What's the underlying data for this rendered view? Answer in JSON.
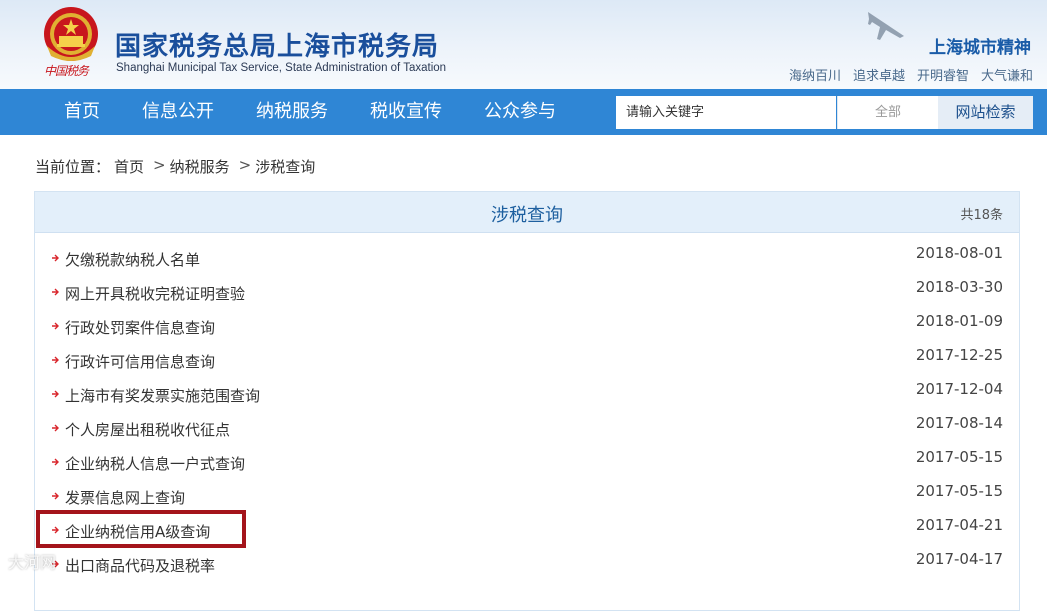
{
  "header": {
    "logo_script": "中国税务",
    "title_cn": "国家税务总局上海市税务局",
    "title_en": "Shanghai Municipal Tax Service, State Administration of Taxation",
    "city_spirit": "上海城市精神",
    "mottos": [
      "海纳百川",
      "追求卓越",
      "开明睿智",
      "大气谦和"
    ]
  },
  "nav": {
    "items": [
      "首页",
      "信息公开",
      "纳税服务",
      "税收宣传",
      "公众参与"
    ]
  },
  "search": {
    "placeholder": "请输入关键字",
    "scope": "全部",
    "button": "网站检索"
  },
  "breadcrumb": {
    "prefix": "当前位置：",
    "items": [
      "首页",
      "纳税服务",
      "涉税查询"
    ],
    "separator": ">"
  },
  "panel": {
    "title": "涉税查询",
    "count": "共18条"
  },
  "list": [
    {
      "title": "欠缴税款纳税人名单",
      "date": "2018-08-01"
    },
    {
      "title": "网上开具税收完税证明查验",
      "date": "2018-03-30"
    },
    {
      "title": "行政处罚案件信息查询",
      "date": "2018-01-09"
    },
    {
      "title": "行政许可信用信息查询",
      "date": "2017-12-25"
    },
    {
      "title": "上海市有奖发票实施范围查询",
      "date": "2017-12-04"
    },
    {
      "title": "个人房屋出租税收代征点",
      "date": "2017-08-14"
    },
    {
      "title": "企业纳税人信息一户式查询",
      "date": "2017-05-15"
    },
    {
      "title": "发票信息网上查询",
      "date": "2017-05-15"
    },
    {
      "title": "企业纳税信用A级查询",
      "date": "2017-04-21"
    },
    {
      "title": "出口商品代码及退税率",
      "date": "2017-04-17"
    }
  ],
  "watermark": "大河网",
  "colors": {
    "nav_bg": "#2f86d5",
    "title_blue": "#1a4f9c",
    "panel_head_bg": "#e3effa",
    "arrow_red": "#d9252b",
    "highlight_border": "#a4141b"
  }
}
